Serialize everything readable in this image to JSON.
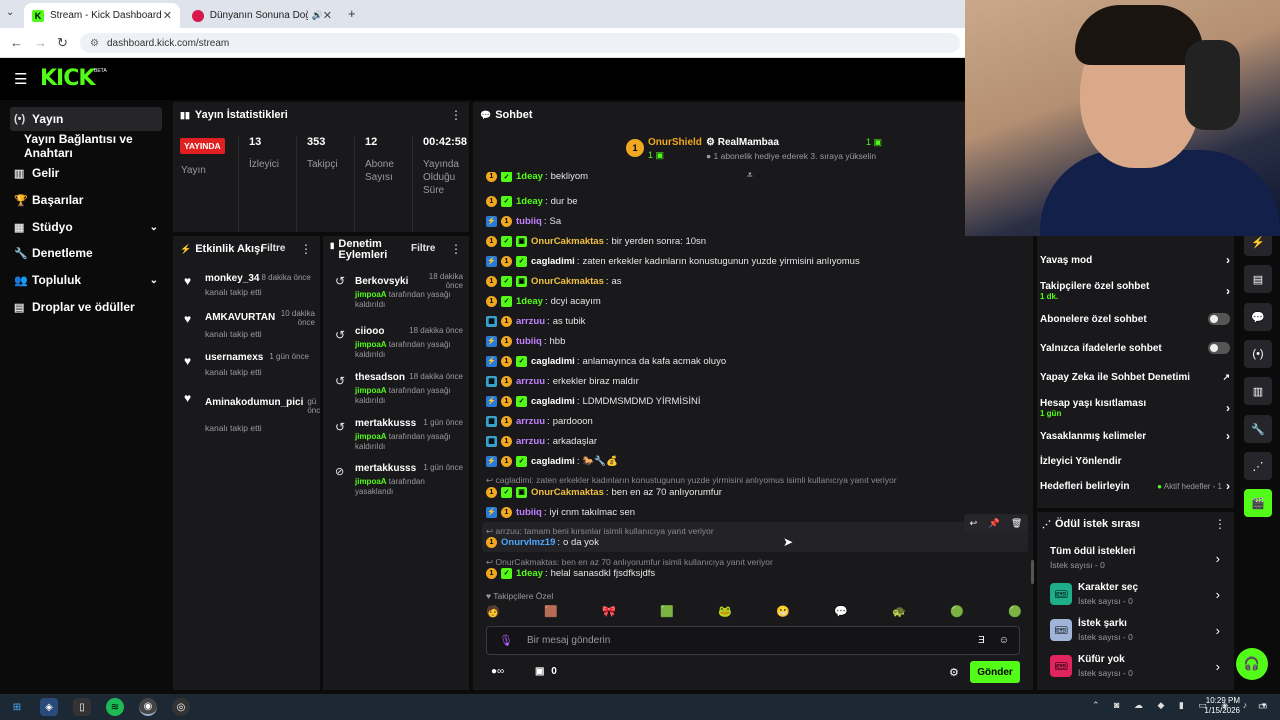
{
  "browser": {
    "tabs": [
      {
        "title": "Stream - Kick Dashboard"
      },
      {
        "title": "Dünyanın Sonuna Doğmuş"
      }
    ],
    "url": "dashboard.kick.com/stream"
  },
  "header": {
    "logo": "KICK",
    "beta": "BETA"
  },
  "sidebar": {
    "items": [
      {
        "label": "Yayın",
        "icon": "broadcast-icon"
      },
      {
        "label": "Yayın Bağlantısı ve Anahtarı"
      },
      {
        "label": "Gelir",
        "icon": "chart-icon"
      },
      {
        "label": "Başarılar",
        "icon": "trophy-icon"
      },
      {
        "label": "Stüdyo",
        "icon": "grid-icon"
      },
      {
        "label": "Denetleme",
        "icon": "wrench-icon"
      },
      {
        "label": "Topluluk",
        "icon": "users-icon"
      },
      {
        "label": "Droplar ve ödüller",
        "icon": "gift-icon"
      }
    ]
  },
  "stats": {
    "title": "Yayın İstatistikleri",
    "live_badge": "YAYINDA",
    "live_label": "Yayın",
    "cols": [
      {
        "value": "13",
        "label": "İzleyici"
      },
      {
        "value": "353",
        "label": "Takipçi"
      },
      {
        "value": "12",
        "label": "Abone Sayısı"
      },
      {
        "value": "00:42:58",
        "label": "Yayında Olduğu Süre"
      }
    ]
  },
  "activity": {
    "title": "Etkinlik Akışı",
    "filter": "Filtre",
    "items": [
      {
        "user": "monkey_34",
        "time": "8 dakika önce",
        "text": "kanalı takip etti"
      },
      {
        "user": "AMKAVURTAN",
        "time": "10 dakika önce",
        "text": "kanalı takip etti"
      },
      {
        "user": "usernamexs",
        "time": "1 gün önce",
        "text": "kanalı takip etti"
      },
      {
        "user": "Aminakodumun_pici",
        "time": "gü önc",
        "text": "kanalı takip etti"
      }
    ]
  },
  "moderation": {
    "title": "Denetim Eylemleri",
    "filter": "Filtre",
    "items": [
      {
        "user": "Berkovsyki",
        "time": "18 dakika önce",
        "actor": "jimpoaA",
        "text": "tarafından yasağı kaldırıldı"
      },
      {
        "user": "ciiooo",
        "time": "18 dakika önce",
        "actor": "jimpoaA",
        "text": "tarafından yasağı kaldırıldı"
      },
      {
        "user": "thesadson",
        "time": "18 dakika önce",
        "actor": "jimpoaA",
        "text": "tarafından yasağı kaldırıldı"
      },
      {
        "user": "mertakkusss",
        "time": "1 gün önce",
        "actor": "jimpoaA",
        "text": "tarafından yasağı kaldırıldı"
      },
      {
        "user": "mertakkusss",
        "time": "1 gün önce",
        "actor": "jimpoaA",
        "text": "tarafından yasaklandı"
      }
    ]
  },
  "chat": {
    "title": "Sohbet",
    "pinned_user1": "OnurShield",
    "pinned_count1": "1",
    "pinned_user2": "RealMambaa",
    "pinned_count2": "1",
    "pinned_sub": "1 abonelik hediye ederek 3. sıraya yükselin",
    "messages": [
      {
        "user": "1deay",
        "text": "bekliyom",
        "color": "#53fc18"
      },
      {
        "user": "1deay",
        "text": "dur be",
        "color": "#53fc18"
      },
      {
        "user": "tubiiq",
        "text": "Sa",
        "color": "#c080ff"
      },
      {
        "user": "OnurCakmaktas",
        "text": "bir yerden sonra: 10sn",
        "color": "#f0c040"
      },
      {
        "user": "cagladimi",
        "text": "zaten erkekler kadınların konustugunun yuzde yirmisini anlıyomus",
        "color": "#ffffff"
      },
      {
        "user": "OnurCakmaktas",
        "text": "as",
        "color": "#f0c040"
      },
      {
        "user": "1deay",
        "text": "dcyi acayım",
        "color": "#53fc18"
      },
      {
        "user": "arrzuu",
        "text": "as tubik",
        "color": "#c080ff"
      },
      {
        "user": "tubiiq",
        "text": "hbb",
        "color": "#c080ff"
      },
      {
        "user": "cagladimi",
        "text": "anlamayınca da kafa acmak oluyo",
        "color": "#ffffff"
      },
      {
        "user": "arrzuu",
        "text": "erkekler biraz maldır",
        "color": "#c080ff"
      },
      {
        "user": "cagladimi",
        "text": "LDMDMSMDMD YİRMİSİNİ",
        "color": "#ffffff"
      },
      {
        "user": "arrzuu",
        "text": "pardooon",
        "color": "#c080ff"
      },
      {
        "user": "arrzuu",
        "text": "arkadaşlar",
        "color": "#c080ff"
      },
      {
        "user": "cagladimi",
        "text": "🐎🔧💰",
        "color": "#ffffff"
      }
    ],
    "reply1": "cagladimi: zaten erkekler kadınların konustugunun yuzde yirmisini anlıyomus isimli kullanıcıya yanıt veriyor",
    "msg_r1_user": "OnurCakmaktas",
    "msg_r1_text": "ben en az 70 anlıyorumfur",
    "msg_t_user": "tubiiq",
    "msg_t_text": "iyi cnm takılmac sen",
    "reply2": "arrzuu: tamam beni kırsınlar isimli kullanıcıya yanıt veriyor",
    "msg_r2_user": "OnurvImz19",
    "msg_r2_text": "o da yok",
    "reply3": "OnurCakmaktas: ben en az 70 anlıyorumfur isimli kullanıcıya yanıt veriyor",
    "msg_r3_user": "1deay",
    "msg_r3_text": "helal sanasdkl fjsdfksjdfs",
    "emote_section": "Takipçilere Özel",
    "input_placeholder": "Bir mesaj gönderin",
    "points": "0",
    "send": "Gönder"
  },
  "settings": {
    "rows": [
      {
        "label": "Yavaş mod",
        "type": "arrow"
      },
      {
        "label": "Takipçilere özel sohbet",
        "sub": "1 dk.",
        "type": "arrow"
      },
      {
        "label": "Abonelere özel sohbet",
        "type": "toggle"
      },
      {
        "label": "Yalnızca ifadelerle sohbet",
        "type": "toggle"
      },
      {
        "label": "Yapay Zeka ile Sohbet Denetimi",
        "type": "ext"
      },
      {
        "label": "Hesap yaşı kısıtlaması",
        "sub": "1 gün",
        "type": "arrow"
      },
      {
        "label": "Yasaklanmış kelimeler",
        "type": "arrow"
      },
      {
        "label": "İzleyici Yönlendir",
        "type": "none"
      },
      {
        "label": "Hedefleri belirleyin",
        "extra": "Aktif hedefler - 1",
        "type": "arrow"
      }
    ]
  },
  "rewards": {
    "title": "Ödül istek sırası",
    "items": [
      {
        "title": "Tüm ödül istekleri",
        "sub": "İstek sayısı - 0",
        "color": ""
      },
      {
        "title": "Karakter seç",
        "sub": "İstek sayısı - 0",
        "color": "#1fae8a"
      },
      {
        "title": "İstek şarkı",
        "sub": "İstek sayısı - 0",
        "color": "#9fb4d8"
      },
      {
        "title": "Küfür yok",
        "sub": "İstek sayısı - 0",
        "color": "#e0245e"
      }
    ]
  },
  "taskbar": {
    "time": "10:29 PM",
    "date": "1/15/2026"
  }
}
